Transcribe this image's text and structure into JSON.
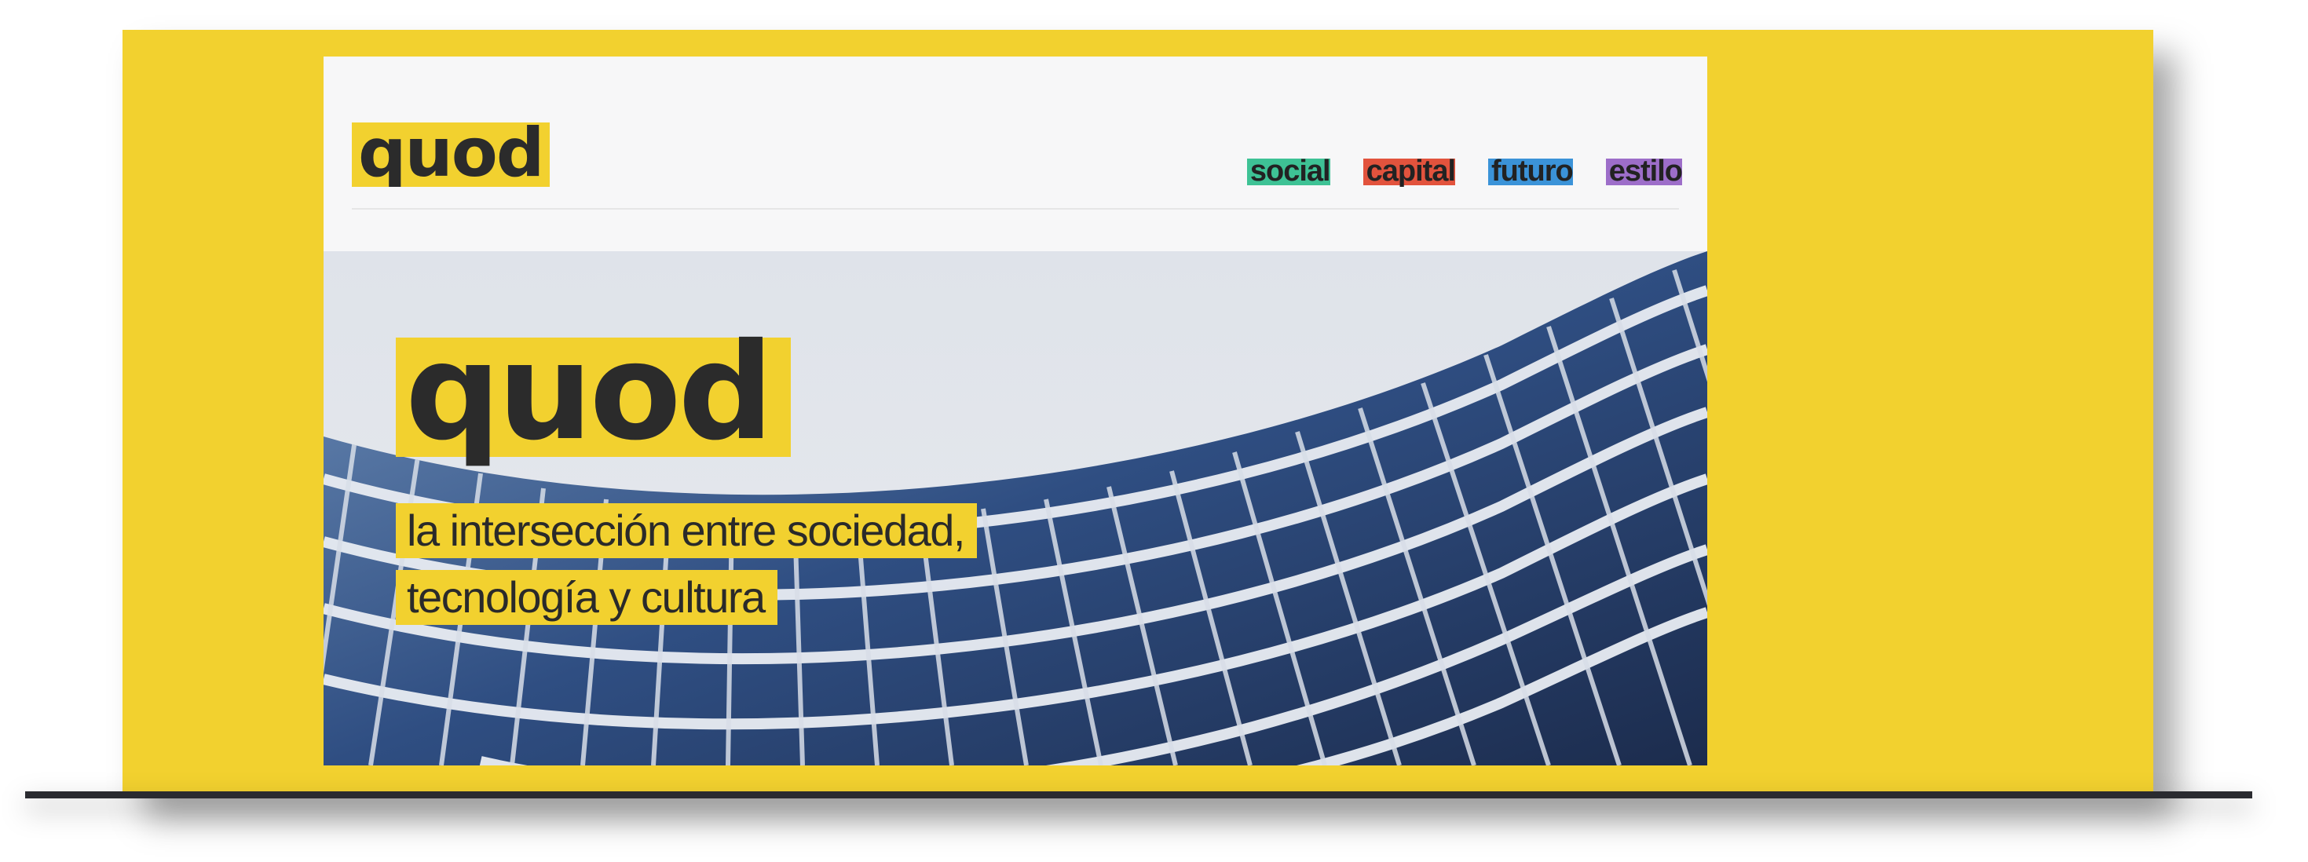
{
  "brand": {
    "logo_text": "quod",
    "accent": "#f2d12f"
  },
  "nav": {
    "items": [
      {
        "label": "social",
        "color": "#3ec295"
      },
      {
        "label": "capital",
        "color": "#e2533d"
      },
      {
        "label": "futuro",
        "color": "#3b93d8"
      },
      {
        "label": "estilo",
        "color": "#9d6ec9"
      }
    ]
  },
  "hero": {
    "logo_text": "quod",
    "tagline_line1": "la intersección entre sociedad,",
    "tagline_line2": "tecnología y cultura",
    "image_subject": "curved-glass-office-building"
  }
}
